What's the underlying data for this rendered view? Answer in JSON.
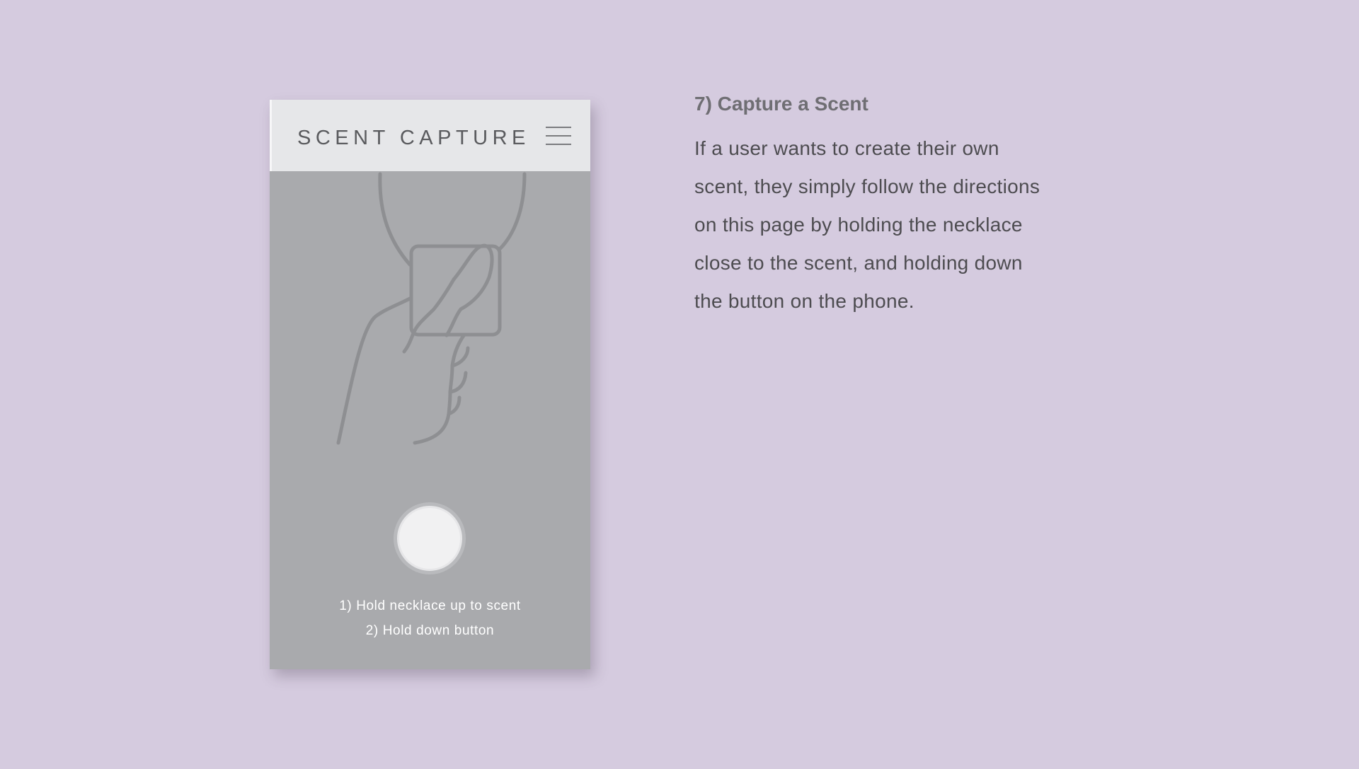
{
  "app": {
    "title": "SCENT CAPTURE",
    "menu_icon": "hamburger-menu-icon"
  },
  "illustration": {
    "icon": "hand-holding-necklace-icon"
  },
  "capture": {
    "button_icon": "record-button-icon"
  },
  "instructions": {
    "step1": "1) Hold necklace up to scent",
    "step2": "2) Hold down button"
  },
  "description": {
    "heading": "7) Capture a Scent",
    "lines": [
      "If a user wants to create their own",
      "scent, they simply follow the directions",
      "on this page by holding the necklace",
      "close to the scent, and holding down",
      "the button on the phone."
    ]
  },
  "colors": {
    "background": "#d5cbdf",
    "phone_screen": "#a9aaad",
    "phone_header": "#e6e7e9",
    "illustration_stroke": "#8e8f92",
    "button_fill": "#f1f1f2",
    "heading_text": "#6f6e73",
    "body_text": "#4d4c50"
  }
}
